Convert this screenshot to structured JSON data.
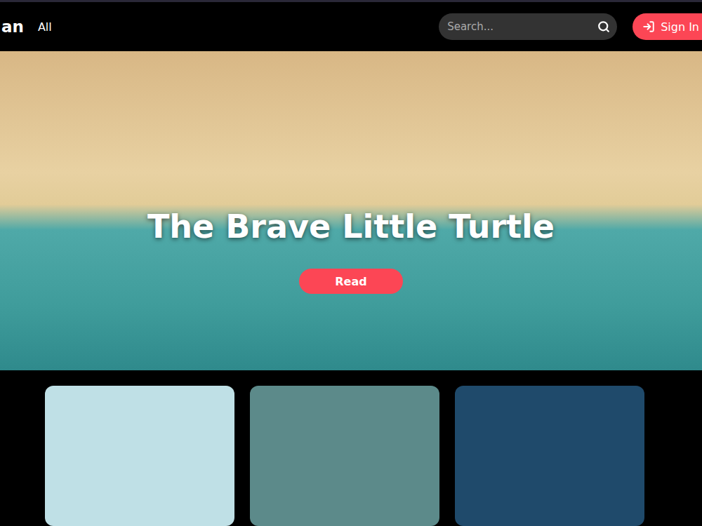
{
  "brand": {
    "text": "an"
  },
  "nav": [
    {
      "label": "All"
    }
  ],
  "search": {
    "placeholder": "Search..."
  },
  "auth": {
    "label": "Sign In"
  },
  "hero": {
    "title": "The Brave Little Turtle",
    "button": "Read"
  },
  "cards": [
    {
      "color": "#bfe0e6"
    },
    {
      "color": "#5c8a8a"
    },
    {
      "color": "#1f4a6b"
    }
  ]
}
